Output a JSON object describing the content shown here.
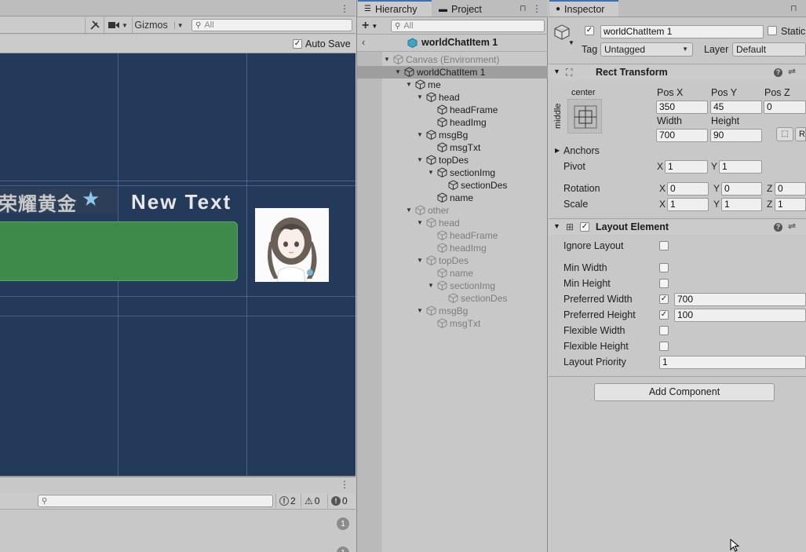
{
  "scene": {
    "gizmos_label": "Gizmos",
    "search_placeholder": "All",
    "auto_save_label": "Auto Save",
    "auto_save_checked": "✓",
    "dim_text": "荣耀黄金",
    "star": "★",
    "new_text": "New Text"
  },
  "console": {
    "errors_count": "2",
    "warnings_count": "0",
    "messages_count": "0",
    "log_badges": [
      "1",
      "1"
    ]
  },
  "hierarchy": {
    "tab_label": "Hierarchy",
    "project_tab_label": "Project",
    "add_label": "+",
    "search_placeholder": "All",
    "scene_title": "worldChatItem 1",
    "rows": [
      {
        "label": "Canvas (Environment)",
        "expand": "▼",
        "dim": true
      },
      {
        "label": "worldChatItem 1",
        "expand": "▼",
        "dim": false
      },
      {
        "label": "me",
        "expand": "▼",
        "dim": false
      },
      {
        "label": "head",
        "expand": "▼",
        "dim": false
      },
      {
        "label": "headFrame",
        "expand": "",
        "dim": false
      },
      {
        "label": "headImg",
        "expand": "",
        "dim": false
      },
      {
        "label": "msgBg",
        "expand": "▼",
        "dim": false
      },
      {
        "label": "msgTxt",
        "expand": "",
        "dim": false
      },
      {
        "label": "topDes",
        "expand": "▼",
        "dim": false
      },
      {
        "label": "sectionImg",
        "expand": "▼",
        "dim": false
      },
      {
        "label": "sectionDes",
        "expand": "",
        "dim": false
      },
      {
        "label": "name",
        "expand": "",
        "dim": false
      },
      {
        "label": "other",
        "expand": "▼",
        "dim": true
      },
      {
        "label": "head",
        "expand": "▼",
        "dim": true
      },
      {
        "label": "headFrame",
        "expand": "",
        "dim": true
      },
      {
        "label": "headImg",
        "expand": "",
        "dim": true
      },
      {
        "label": "topDes",
        "expand": "▼",
        "dim": true
      },
      {
        "label": "name",
        "expand": "",
        "dim": true
      },
      {
        "label": "sectionImg",
        "expand": "▼",
        "dim": true
      },
      {
        "label": "sectionDes",
        "expand": "",
        "dim": true
      },
      {
        "label": "msgBg",
        "expand": "▼",
        "dim": true
      },
      {
        "label": "msgTxt",
        "expand": "",
        "dim": true
      }
    ]
  },
  "inspector": {
    "tab_label": "Inspector",
    "object_name": "worldChatItem 1",
    "static_label": "Static",
    "tag_label": "Tag",
    "tag_value": "Untagged",
    "layer_label": "Layer",
    "layer_value": "Default",
    "rect_transform": {
      "title": "Rect Transform",
      "anchor_h": "center",
      "anchor_v": "middle",
      "pos_x_label": "Pos X",
      "pos_y_label": "Pos Y",
      "pos_z_label": "Pos Z",
      "pos_x": "350",
      "pos_y": "45",
      "pos_z": "0",
      "width_label": "Width",
      "height_label": "Height",
      "width": "700",
      "height": "90",
      "r_button": "R",
      "anchors_label": "Anchors",
      "pivot_label": "Pivot",
      "pivot_x": "1",
      "pivot_y": "1",
      "rotation_label": "Rotation",
      "rot_x": "0",
      "rot_y": "0",
      "rot_z": "0",
      "scale_label": "Scale",
      "scale_x": "1",
      "scale_y": "1",
      "scale_z": "1",
      "x": "X",
      "y": "Y",
      "z": "Z"
    },
    "layout_element": {
      "title": "Layout Element",
      "enabled": "✓",
      "ignore_layout": "Ignore Layout",
      "min_width": "Min Width",
      "min_height": "Min Height",
      "preferred_width": "Preferred Width",
      "preferred_width_value": "700",
      "preferred_height": "Preferred Height",
      "preferred_height_value": "100",
      "flexible_width": "Flexible Width",
      "flexible_height": "Flexible Height",
      "layout_priority": "Layout Priority",
      "layout_priority_value": "1",
      "check": "✓"
    },
    "add_component": "Add Component"
  }
}
